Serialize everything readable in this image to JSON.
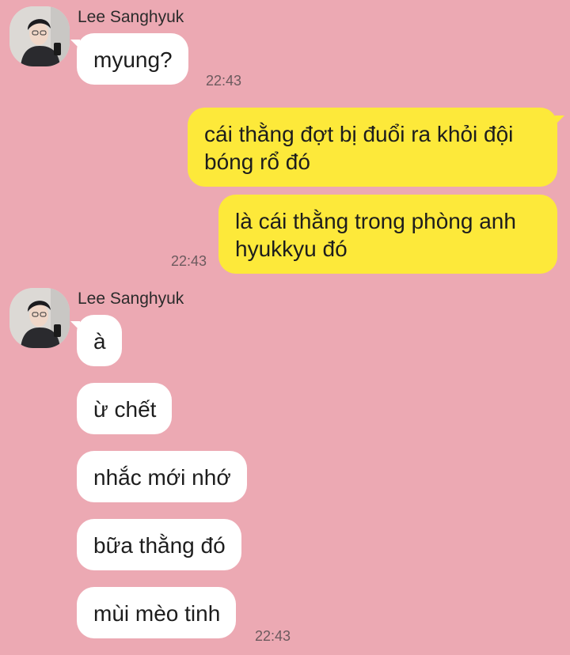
{
  "sender_name": "Lee Sanghyuk",
  "groups": [
    {
      "sender": "Lee Sanghyuk",
      "messages": [
        {
          "text": "myung?",
          "time": "22:43"
        }
      ]
    },
    {
      "sender": "me",
      "messages": [
        {
          "text": "cái thằng đợt bị đuổi ra khỏi đội bóng rổ đó"
        },
        {
          "text": "là cái thằng trong phòng anh hyukkyu đó",
          "time": "22:43"
        }
      ]
    },
    {
      "sender": "Lee Sanghyuk",
      "messages": [
        {
          "text": "à"
        },
        {
          "text": "ừ chết"
        },
        {
          "text": "nhắc mới nhớ"
        },
        {
          "text": "bữa thằng đó"
        },
        {
          "text": "mùi mèo tinh",
          "time": "22:43"
        }
      ]
    }
  ],
  "colors": {
    "background": "#eca9b3",
    "incoming_bubble": "#ffffff",
    "outgoing_bubble": "#fde93a"
  },
  "icons": {
    "avatar": "profile-photo-avatar"
  }
}
